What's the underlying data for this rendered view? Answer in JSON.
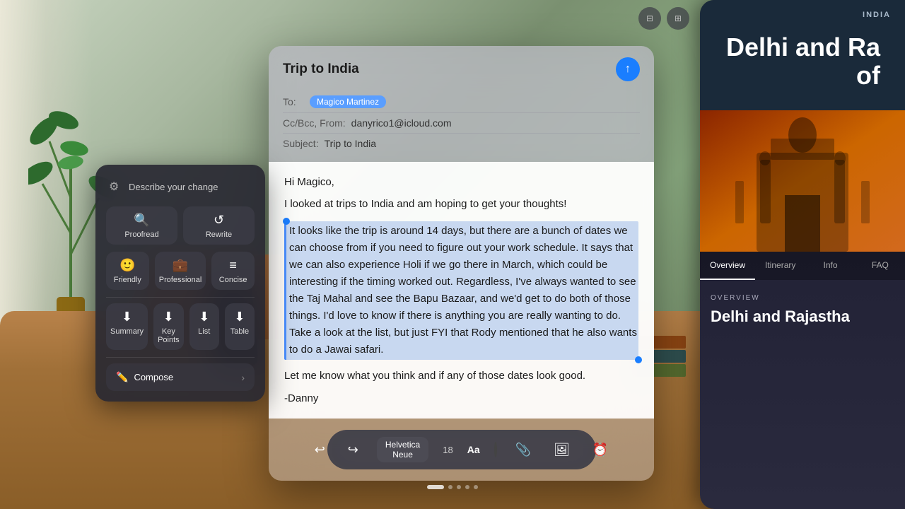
{
  "background": {
    "description": "Living room with plants and wooden furniture"
  },
  "window_controls": {
    "minimize_label": "⊟",
    "expand_label": "⊞"
  },
  "writing_tools": {
    "title": "Describe your change",
    "proofread_label": "Proofread",
    "rewrite_label": "Rewrite",
    "friendly_label": "Friendly",
    "professional_label": "Professional",
    "concise_label": "Concise",
    "summary_label": "Summary",
    "key_points_label": "Key Points",
    "list_label": "List",
    "table_label": "Table",
    "compose_label": "Compose",
    "proofread_icon": "🔍",
    "rewrite_icon": "↺",
    "friendly_icon": "☺",
    "professional_icon": "👔",
    "concise_icon": "≡",
    "summary_icon": "⬇",
    "key_points_icon": "⬇",
    "list_icon": "⬇",
    "table_icon": "⬇"
  },
  "mail": {
    "title": "Trip to India",
    "to_label": "To:",
    "recipient": "Magico Martinez",
    "ccbcc_label": "Cc/Bcc, From:",
    "from_email": "danyrico1@icloud.com",
    "subject_label": "Subject:",
    "subject": "Trip to India",
    "body": {
      "greeting": "Hi Magico,",
      "intro": "I looked at trips to India and am hoping to get your thoughts!",
      "highlighted": "It looks like the trip is around 14 days, but there are a bunch of dates we can choose from if you need to figure out your work schedule. It says that we can also experience Holi if we go there in March, which could be interesting if the timing worked out. Regardless, I've always wanted to see the Taj Mahal and see the Bapu Bazaar, and we'd get to do both of those things.  I'd love to know if there is anything you are really wanting to do. Take a look at the list, but just FYI that Rody mentioned that he also wants to do a Jawai safari.",
      "closing": "Let me know what you think and if any of those dates look good.",
      "signature": "-Danny"
    }
  },
  "toolbar": {
    "undo_icon": "↩",
    "redo_icon": "↪",
    "font_name": "Helvetica Neue",
    "font_size": "18",
    "format_aa": "Aa",
    "attachment_icon": "📎",
    "image_icon": "🖼",
    "time_icon": "⏰"
  },
  "india_panel": {
    "country_label": "INDIA",
    "title": "Delhi and Ra",
    "subtitle": "of",
    "nav_items": [
      "Overview",
      "Itinerary",
      "Info",
      "FAQ"
    ],
    "active_nav": "Overview",
    "overview_label": "OVERVIEW",
    "overview_title": "Delhi and Rajastha"
  },
  "dots": [
    "active",
    "inactive",
    "inactive",
    "inactive",
    "inactive"
  ]
}
